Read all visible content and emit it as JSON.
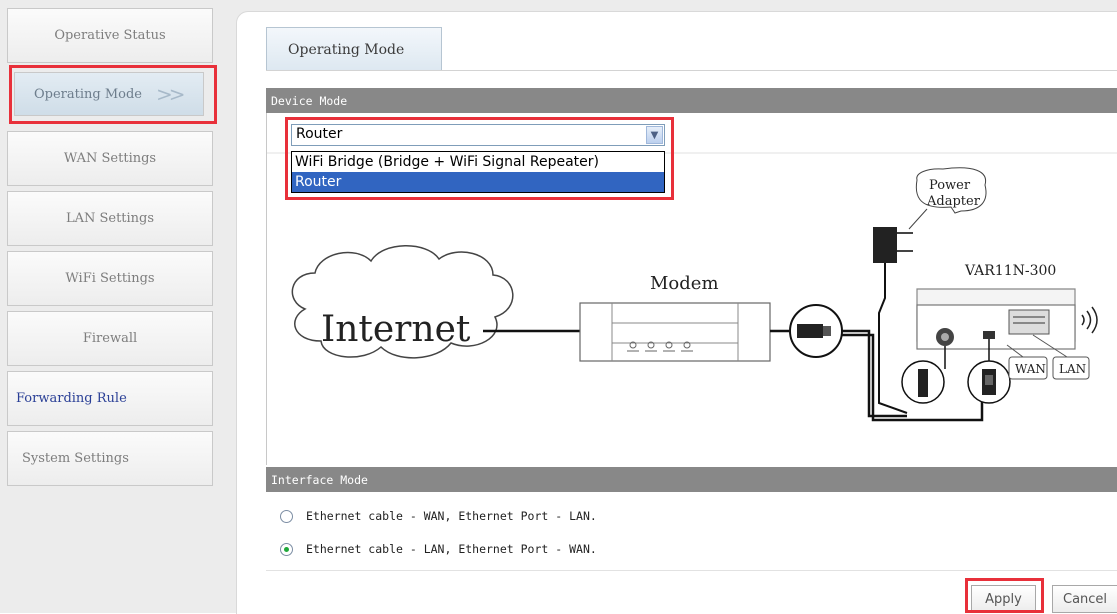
{
  "sidebar": {
    "items": [
      {
        "label": "Operative Status"
      },
      {
        "label": "Operating Mode",
        "arrow": ">>"
      },
      {
        "label": "WAN Settings"
      },
      {
        "label": "LAN Settings"
      },
      {
        "label": "WiFi Settings"
      },
      {
        "label": "Firewall"
      },
      {
        "label": "Forwarding Rule"
      },
      {
        "label": "System Settings"
      }
    ]
  },
  "main": {
    "tab_label": "Operating Mode",
    "device_mode": {
      "header": "Device Mode",
      "selected": "Router",
      "options": [
        "WiFi Bridge (Bridge + WiFi Signal Repeater)",
        "Router"
      ]
    },
    "diagram": {
      "internet": "Internet",
      "modem": "Modem",
      "power_adapter_line1": "Power",
      "power_adapter_line2": "Adapter",
      "device_model": "VAR11N-300",
      "wan": "WAN",
      "lan": "LAN"
    },
    "interface_mode": {
      "header": "Interface Mode",
      "options": [
        {
          "label": "Ethernet cable - WAN, Ethernet Port - LAN.",
          "checked": false
        },
        {
          "label": "Ethernet cable - LAN, Ethernet Port - WAN.",
          "checked": true
        }
      ]
    },
    "buttons": {
      "apply": "Apply",
      "cancel": "Cancel"
    }
  },
  "colors": {
    "highlight": "#e8303a",
    "section_header": "#888888",
    "selected_option": "#3165c1",
    "forward_link": "#2a3f96"
  }
}
